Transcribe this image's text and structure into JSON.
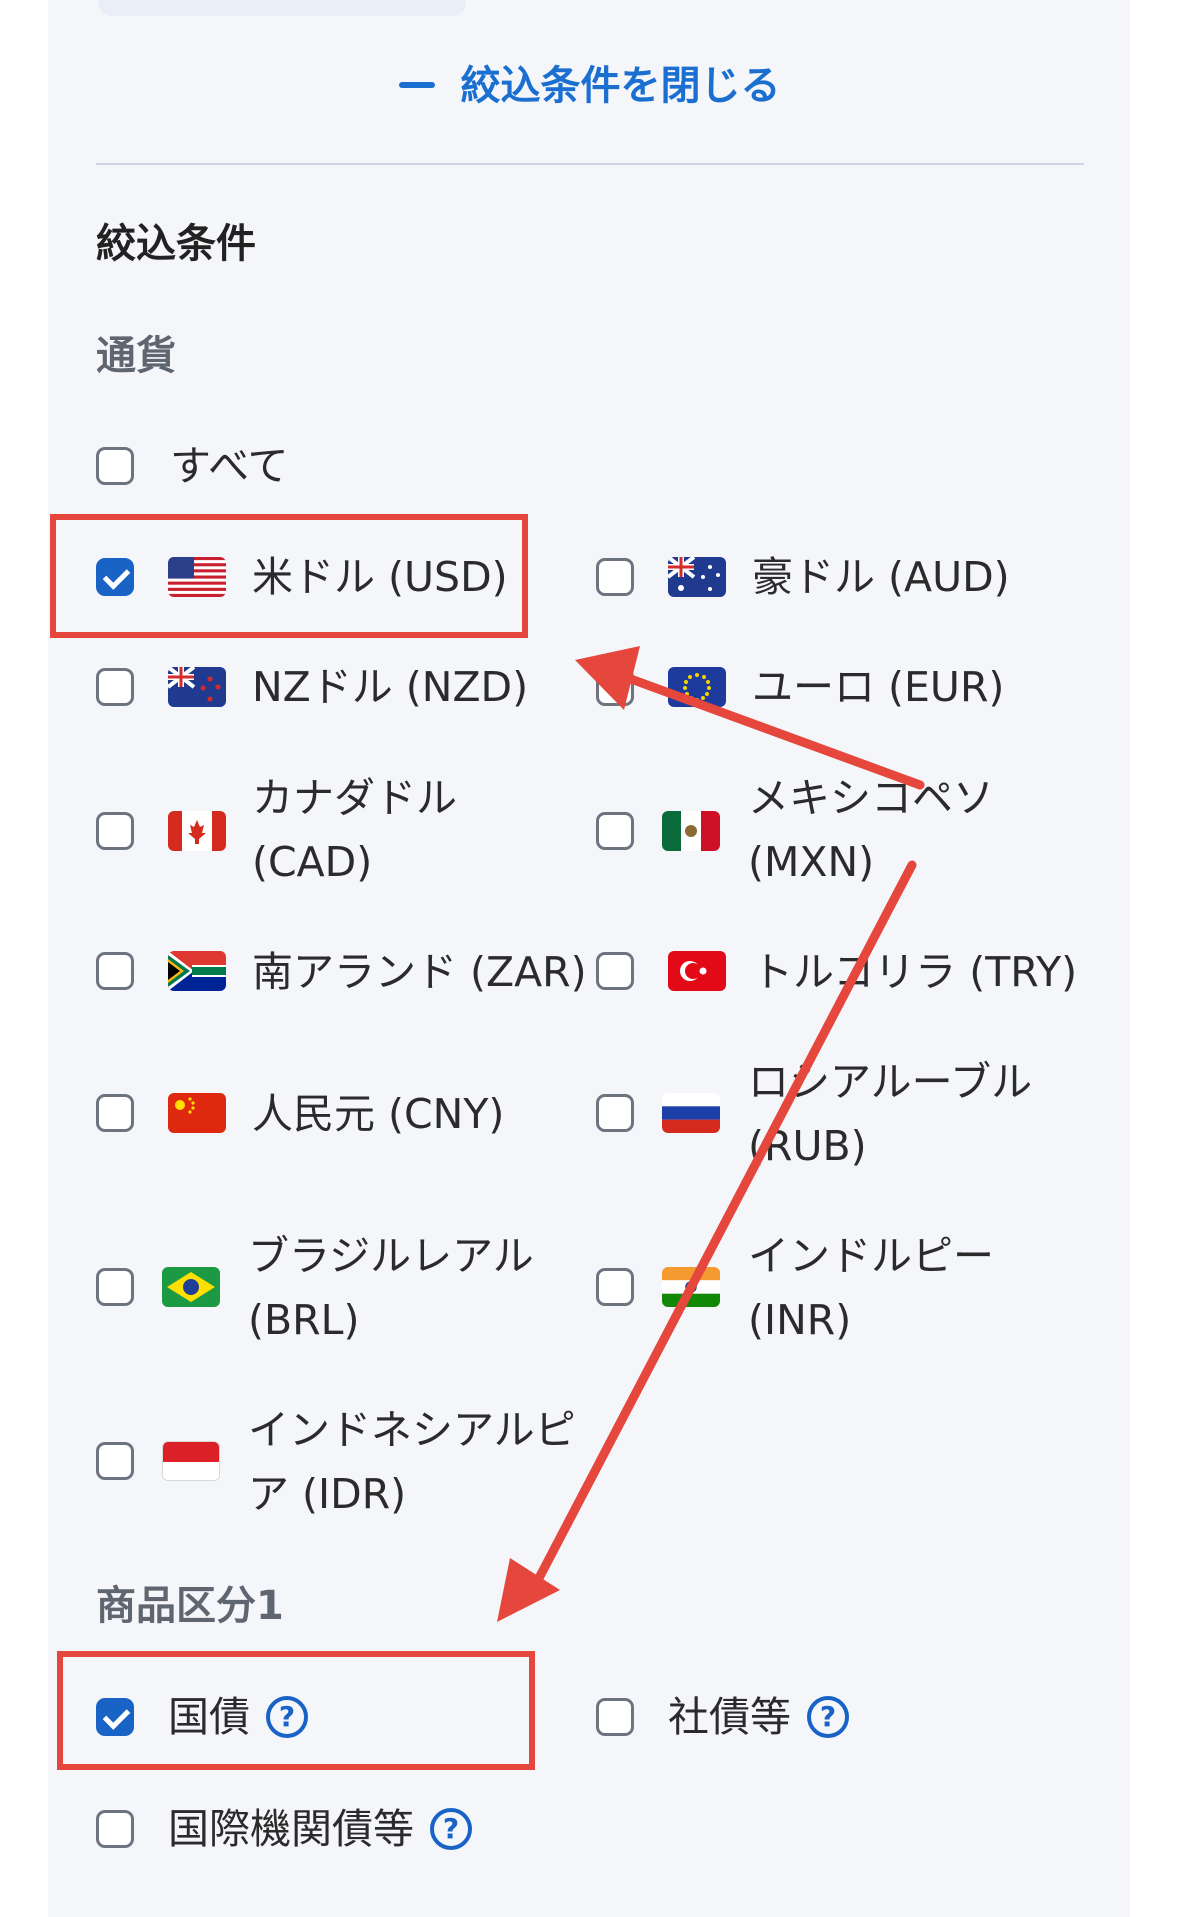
{
  "filter_panel": {
    "close_toggle_label": "絞込条件を閉じる",
    "section_title": "絞込条件",
    "currency_group": {
      "label": "通貨",
      "all_option": {
        "label": "すべて",
        "checked": false
      },
      "options": [
        {
          "label": "米ドル (USD)",
          "flag": "us-flag-icon",
          "checked": true
        },
        {
          "label": "豪ドル (AUD)",
          "flag": "au-flag-icon",
          "checked": false
        },
        {
          "label": "NZドル (NZD)",
          "flag": "nz-flag-icon",
          "checked": false
        },
        {
          "label": "ユーロ (EUR)",
          "flag": "eu-flag-icon",
          "checked": false
        },
        {
          "label_line1": "カナダドル",
          "label_line2": "(CAD)",
          "flag": "ca-flag-icon",
          "checked": false
        },
        {
          "label_line1": "メキシコペソ",
          "label_line2": "(MXN)",
          "flag": "mx-flag-icon",
          "checked": false
        },
        {
          "label": "南アランド (ZAR)",
          "flag": "za-flag-icon",
          "checked": false
        },
        {
          "label": "トルコリラ (TRY)",
          "flag": "tr-flag-icon",
          "checked": false
        },
        {
          "label": "人民元 (CNY)",
          "flag": "cn-flag-icon",
          "checked": false
        },
        {
          "label_line1": "ロシアルーブル",
          "label_line2": "(RUB)",
          "flag": "ru-flag-icon",
          "checked": false
        },
        {
          "label_line1": "ブラジルレアル",
          "label_line2": "(BRL)",
          "flag": "br-flag-icon",
          "checked": false
        },
        {
          "label_line1": "インドルピー",
          "label_line2": "(INR)",
          "flag": "in-flag-icon",
          "checked": false
        },
        {
          "label_line1": "インドネシアルピ",
          "label_line2": "ア (IDR)",
          "flag": "id-flag-icon",
          "checked": false
        }
      ]
    },
    "product_group": {
      "label": "商品区分1",
      "options": [
        {
          "label": "国債",
          "checked": true,
          "help": "?"
        },
        {
          "label": "社債等",
          "checked": false,
          "help": "?"
        },
        {
          "label": "国際機関債等",
          "checked": false,
          "help": "?"
        }
      ]
    }
  },
  "annotation_color": "#e5473c",
  "accent_color": "#1a63c6"
}
